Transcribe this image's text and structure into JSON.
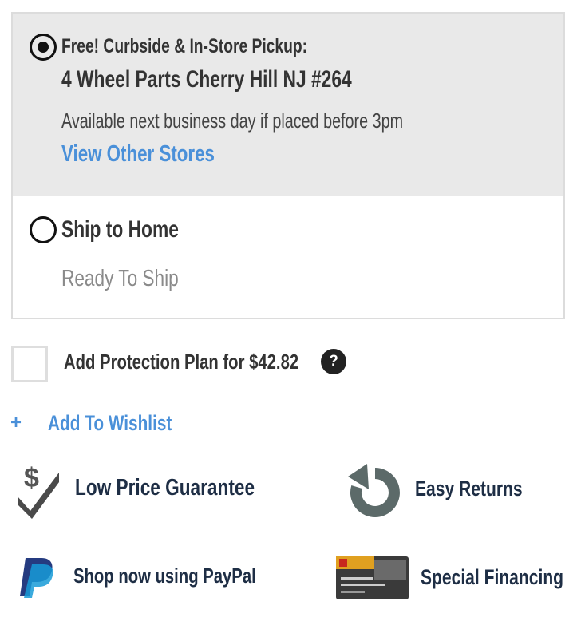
{
  "fulfillment": {
    "pickup": {
      "label": "Free! Curbside & In-Store Pickup:",
      "store": "4 Wheel Parts Cherry Hill NJ #264",
      "availability": "Available next business day if placed before 3pm",
      "link": "View Other Stores",
      "selected": true
    },
    "ship": {
      "label": "Ship to Home",
      "status": "Ready To Ship",
      "selected": false
    }
  },
  "protection": {
    "label": "Add Protection Plan for $42.82",
    "help": "?"
  },
  "wishlist": {
    "plus": "+",
    "label": "Add To Wishlist"
  },
  "features": [
    {
      "label": "Low Price Guarantee",
      "icon": "dollar-check-icon"
    },
    {
      "label": "Easy Returns",
      "icon": "return-arrow-icon"
    },
    {
      "label": "Shop now using PayPal",
      "icon": "paypal-icon"
    },
    {
      "label": "Special Financing",
      "icon": "credit-card-icon"
    }
  ],
  "colors": {
    "link": "#4a90d9",
    "heading": "#333333",
    "feature_text": "#1e2e45",
    "selected_bg": "#e9e9e9"
  }
}
